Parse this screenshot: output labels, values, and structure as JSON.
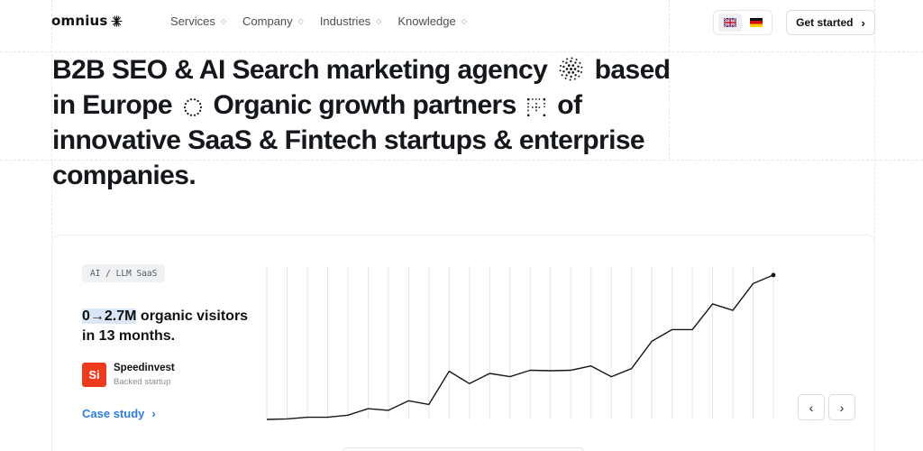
{
  "brand": {
    "name": "omnius"
  },
  "nav": {
    "items": [
      {
        "label": "Services"
      },
      {
        "label": "Company"
      },
      {
        "label": "Industries"
      },
      {
        "label": "Knowledge"
      }
    ]
  },
  "languages": [
    {
      "code": "en",
      "icon": "uk-flag-icon",
      "active": true
    },
    {
      "code": "de",
      "icon": "germany-flag-icon",
      "active": false
    }
  ],
  "header": {
    "cta_label": "Get started"
  },
  "hero": {
    "part1": "B2B SEO & AI Search marketing agency",
    "part2": "based in Europe",
    "part3": "Organic growth partners",
    "part4": "of innovative SaaS & Fintech startups & enterprise companies."
  },
  "case": {
    "tag": "AI / LLM SaaS",
    "stat_highlight": "0→2.7M",
    "stat_rest": "organic visitors in 13 months.",
    "company_logo_text": "Si",
    "company_name": "Speedinvest",
    "company_sub": "Backed startup",
    "link_label": "Case study"
  },
  "colors": {
    "accent_link": "#2e7de0",
    "company_logo_bg": "#ee3b1d",
    "stat_highlight_bg": "#dbe6f7"
  },
  "chart_data": {
    "type": "line",
    "title": "",
    "xlabel": "",
    "ylabel": "",
    "grid": true,
    "ylim": [
      0,
      2.8
    ],
    "series": [
      {
        "values": [
          0.0,
          0.01,
          0.04,
          0.04,
          0.08,
          0.2,
          0.17,
          0.35,
          0.28,
          0.9,
          0.67,
          0.86,
          0.8,
          0.92,
          0.91,
          0.92,
          1.0,
          0.8,
          0.95,
          1.46,
          1.68,
          1.68,
          2.16,
          2.04,
          2.54,
          2.7
        ]
      }
    ]
  }
}
